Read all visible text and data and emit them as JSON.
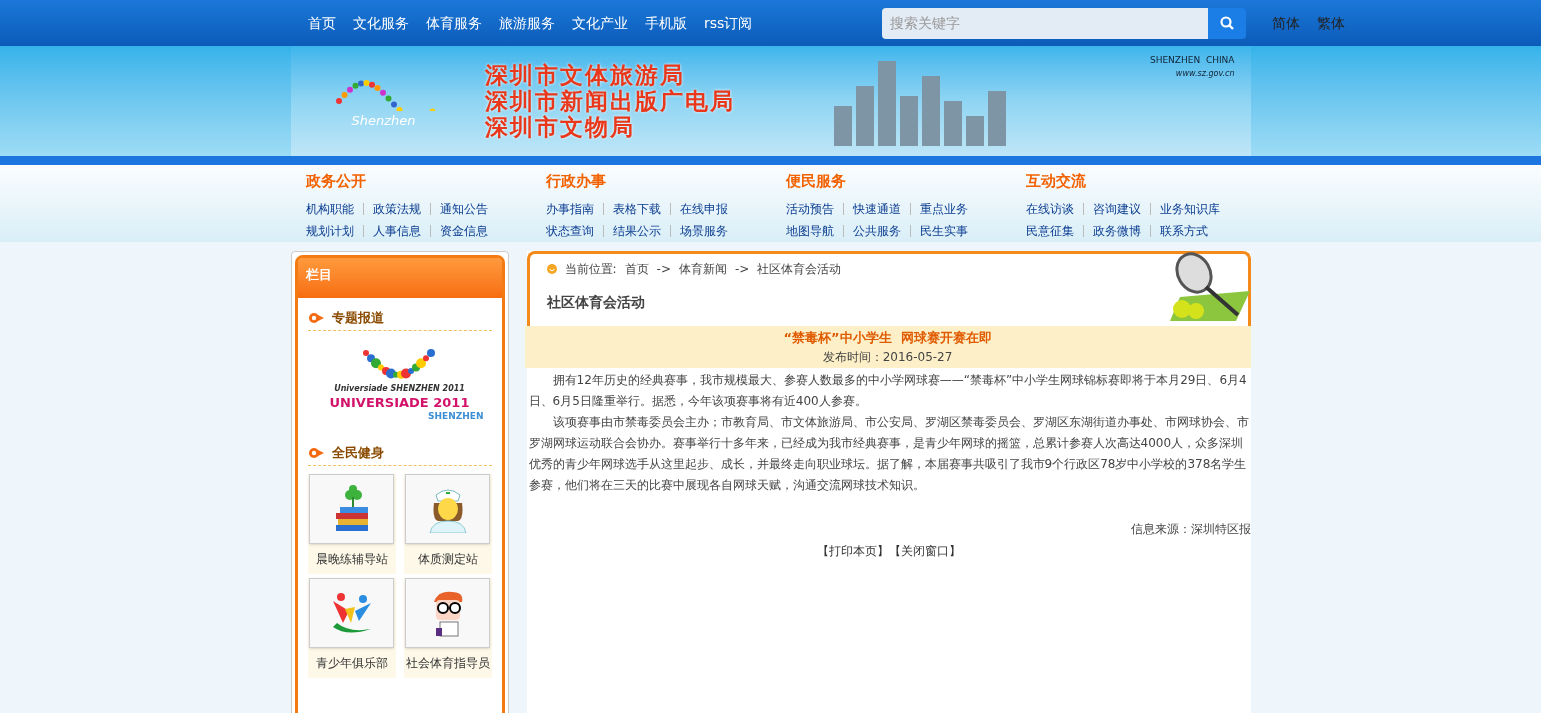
{
  "top_nav": {
    "links": [
      "首页",
      "文化服务",
      "体育服务",
      "旅游服务",
      "文化产业",
      "手机版",
      "rss订阅"
    ],
    "search": {
      "placeholder": "搜索关键字"
    },
    "lang_links": [
      "简体",
      "繁体"
    ]
  },
  "banner": {
    "titles": [
      "深圳市文体旅游局",
      "深圳市新闻出版广电局",
      "深圳市文物局"
    ],
    "logo_text": "Shenzhen",
    "right_logo": "SHENZHEN  CHINA",
    "url": "www.sz.gov.cn"
  },
  "menu_groups": [
    {
      "title": "政务公开",
      "rows": [
        [
          "机构职能",
          "政策法规",
          "通知公告"
        ],
        [
          "规划计划",
          "人事信息",
          "资金信息"
        ]
      ]
    },
    {
      "title": "行政办事",
      "rows": [
        [
          "办事指南",
          "表格下载",
          "在线申报"
        ],
        [
          "状态查询",
          "结果公示",
          "场景服务"
        ]
      ]
    },
    {
      "title": "便民服务",
      "rows": [
        [
          "活动预告",
          "快速通道",
          "重点业务"
        ],
        [
          "地图导航",
          "公共服务",
          "民生实事"
        ]
      ]
    },
    {
      "title": "互动交流",
      "rows": [
        [
          "在线访谈",
          "咨询建议",
          "业务知识库"
        ],
        [
          "民意征集",
          "政务微博",
          "联系方式"
        ]
      ]
    }
  ],
  "sidebar": {
    "title": "栏目",
    "sections": [
      {
        "kind": "logo",
        "title": "专题报道",
        "caption": "Universiade SHENZHEN 2011",
        "logo_title": "UNIVERSIADE 2011",
        "logo_sub": "SHENZHEN"
      },
      {
        "kind": "tiles",
        "title": "全民健身",
        "tiles": [
          "晨晚练辅导站",
          "体质测定站",
          "青少年俱乐部",
          "社会体育指导员"
        ]
      }
    ]
  },
  "article": {
    "breadcrumb_label": "当前位置:",
    "breadcrumb": [
      "首页",
      "体育新闻",
      "社区体育会活动"
    ],
    "separator": "->",
    "section_title": "社区体育会活动",
    "headline": "“禁毒杯”中小学生  网球赛开赛在即",
    "date": "发布时间：2016-05-27",
    "paragraphs": [
      "拥有12年历史的经典赛事，我市规模最大、参赛人数最多的中小学网球赛——“禁毒杯”中小学生网球锦标赛即将于本月29日、6月4日、6月5日隆重举行。据悉，今年该项赛事将有近400人参赛。",
      "该项赛事由市禁毒委员会主办；市教育局、市文体旅游局、市公安局、罗湖区禁毒委员会、罗湖区东湖街道办事处、市网球协会、市罗湖网球运动联合会协办。赛事举行十多年来，已经成为我市经典赛事，是青少年网球的摇篮，总累计参赛人次高达4000人，众多深圳优秀的青少年网球选手从这里起步、成长，并最终走向职业球坛。据了解，本届赛事共吸引了我市9个行政区78岁中小学校的378名学生参赛，他们将在三天的比赛中展现各自网球天赋，沟通交流网球技术知识。"
    ],
    "source": "信息来源：深圳特区报",
    "actions": [
      "【打印本页】",
      "【关闭窗口】"
    ]
  }
}
